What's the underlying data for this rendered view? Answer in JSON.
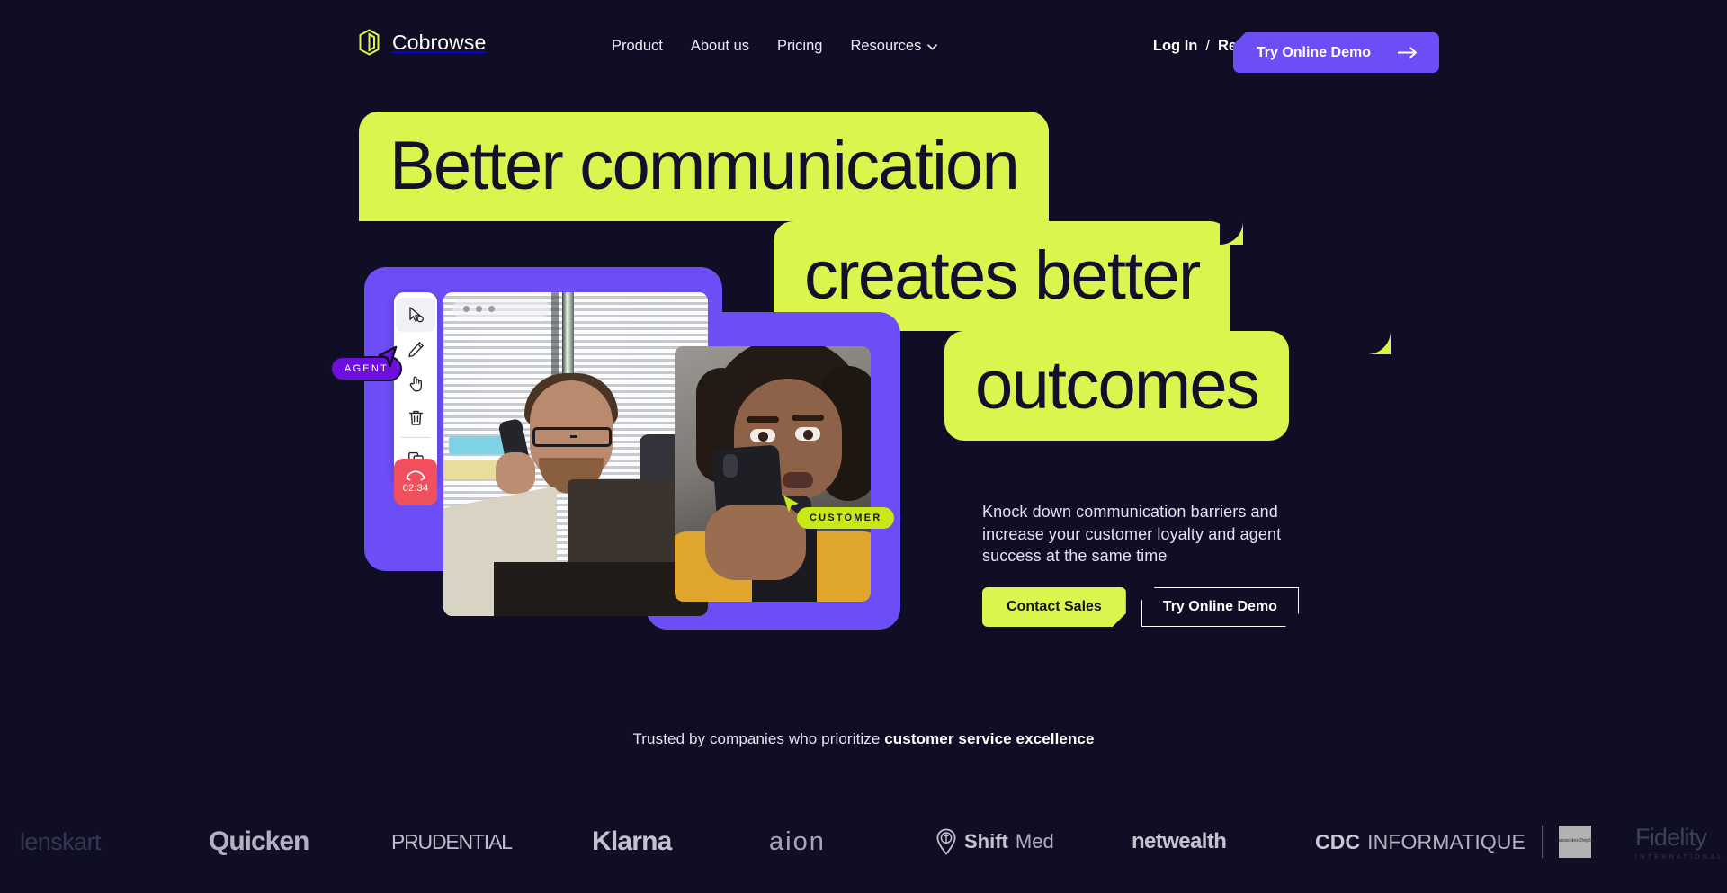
{
  "brand": {
    "name": "Cobrowse",
    "logo_icon": "cobrowse-logo-icon"
  },
  "nav": {
    "links": [
      {
        "label": "Product",
        "icon": null
      },
      {
        "label": "About us",
        "icon": null
      },
      {
        "label": "Pricing",
        "icon": null
      },
      {
        "label": "Resources",
        "icon": "chevron-down-icon"
      }
    ],
    "login_label": "Log In",
    "separator": "/",
    "register_label": "Register",
    "demo_button": {
      "label": "Try Online Demo",
      "icon": "arrow-right-icon",
      "color": "#6c4df6"
    }
  },
  "hero": {
    "headline_lines": [
      "Better communication",
      "creates better",
      "outcomes"
    ],
    "highlight_color": "#dcf54e",
    "headline_text_color": "#12102a",
    "paragraph": "Knock down communication barriers and increase your customer loyalty and agent success at the same time",
    "cta_primary": {
      "label": "Contact Sales",
      "color": "#dcf54e"
    },
    "cta_secondary": {
      "label": "Try Online Demo"
    }
  },
  "widget": {
    "panel_color": "#6c4df6",
    "tools": [
      {
        "name": "cursor-select-icon",
        "active": true
      },
      {
        "name": "pencil-draw-icon",
        "active": false
      },
      {
        "name": "hand-pointer-icon",
        "active": false
      },
      {
        "name": "trash-delete-icon",
        "active": false
      },
      {
        "name": "screen-share-icon",
        "active": false
      }
    ],
    "end_call": {
      "icon": "end-call-icon",
      "timer": "02:34",
      "color": "#f0505c"
    },
    "agent_badge": {
      "label": "AGENT",
      "color": "#6e0fe0"
    },
    "customer_badge": {
      "label": "CUSTOMER",
      "color": "#c8e817"
    },
    "window_dots": 3
  },
  "trusted": {
    "prefix": "Trusted by companies who prioritize ",
    "emphasis": "customer service excellence",
    "logos": [
      {
        "name": "lenskart",
        "text": "lenskart"
      },
      {
        "name": "quicken",
        "text": "Quicken"
      },
      {
        "name": "prudential",
        "text": "PRUDENTIAL"
      },
      {
        "name": "klarna",
        "text": "Klarna"
      },
      {
        "name": "aion",
        "text": "aion"
      },
      {
        "name": "shiftmed",
        "text": "Shift",
        "text2": "Med"
      },
      {
        "name": "netwealth",
        "text": "netwealth"
      },
      {
        "name": "cdc-informatique",
        "text": "CDC",
        "text2": "INFORMATIQUE",
        "seal": "Caisse des Dépôts"
      },
      {
        "name": "fidelity",
        "text": "Fidelity",
        "text2": "INTERNATIONAL"
      }
    ]
  }
}
